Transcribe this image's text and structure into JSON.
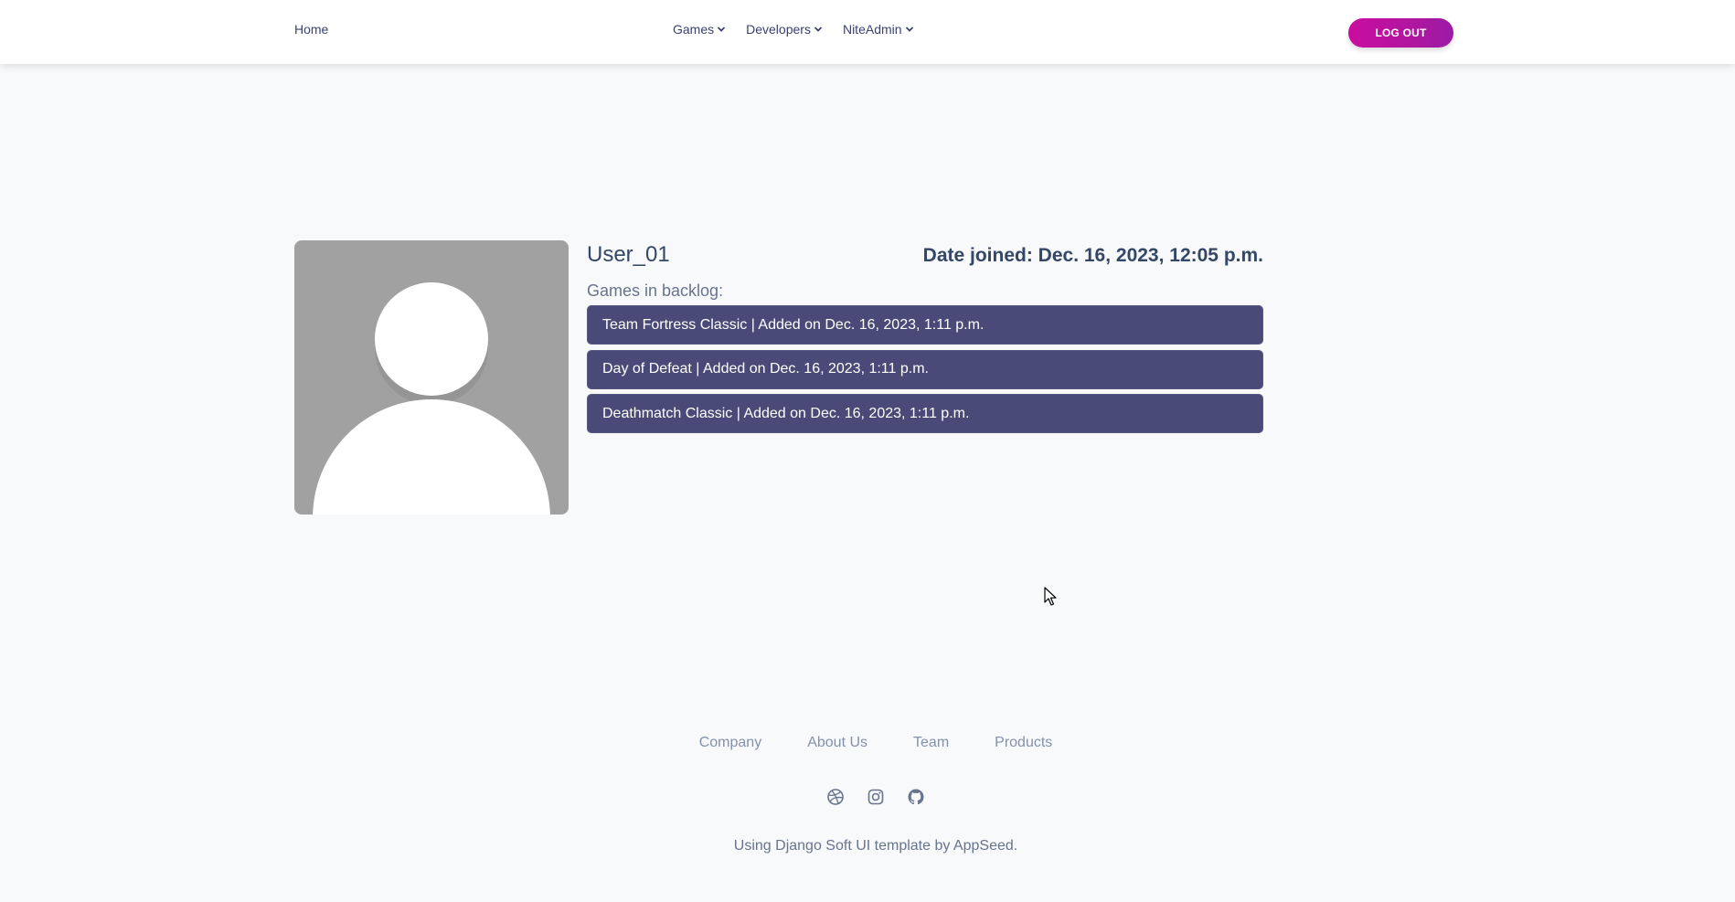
{
  "navbar": {
    "home_label": "Home",
    "menus": [
      {
        "label": "Games"
      },
      {
        "label": "Developers"
      },
      {
        "label": "NiteAdmin"
      }
    ],
    "logout_label": "LOG OUT"
  },
  "profile": {
    "username": "User_01",
    "date_joined": "Date joined: Dec. 16, 2023, 12:05 p.m.",
    "backlog_label": "Games in backlog:",
    "backlog": [
      {
        "text": "Team Fortress Classic | Added on Dec. 16, 2023, 1:11 p.m."
      },
      {
        "text": "Day of Defeat | Added on Dec. 16, 2023, 1:11 p.m."
      },
      {
        "text": "Deathmatch Classic | Added on Dec. 16, 2023, 1:11 p.m."
      }
    ]
  },
  "footer": {
    "links": [
      "Company",
      "About Us",
      "Team",
      "Products"
    ],
    "social_icons": [
      "dribbble-icon",
      "instagram-icon",
      "github-icon"
    ],
    "credit": "Using Django Soft UI template by AppSeed."
  },
  "colors": {
    "accent": "#cb0c9f",
    "backlog_item_bg": "#4a4a78",
    "avatar_bg": "#a1a1a1",
    "page_bg": "#f8f9fa"
  }
}
